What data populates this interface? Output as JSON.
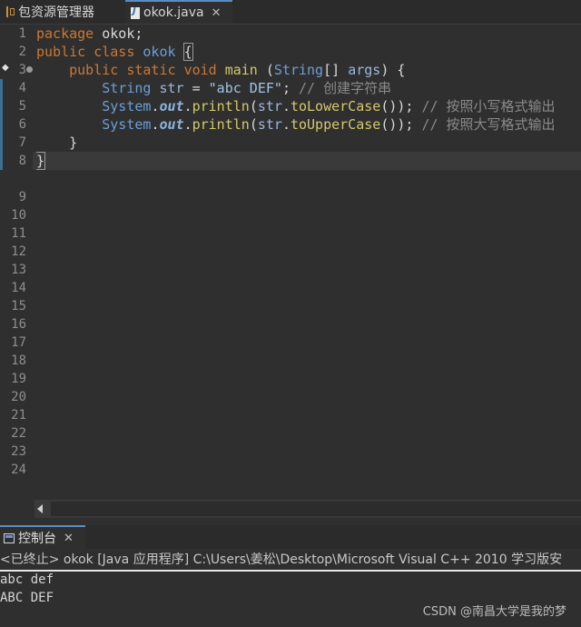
{
  "tabs": {
    "explorer_label": "包资源管理器",
    "editor_label": "okok.java",
    "close_glyph": "✕"
  },
  "editor": {
    "line_numbers": [
      "1",
      "2",
      "3",
      "4",
      "5",
      "6",
      "7",
      "8",
      "9",
      "10",
      "11",
      "12",
      "13",
      "14",
      "15",
      "16",
      "17",
      "18",
      "19",
      "20",
      "21",
      "22",
      "23",
      "24"
    ],
    "code": {
      "l1_kw": "package",
      "l1_rest": " okok;",
      "l2_kw1": "public",
      "l2_kw2": "class",
      "l2_name": "okok",
      "l2_brace": "{",
      "l3_kw1": "public",
      "l3_kw2": "static",
      "l3_kw3": "void",
      "l3_meth": "main",
      "l3_open": " (",
      "l3_type": "String",
      "l3_arr": "[] ",
      "l3_param": "args",
      "l3_close": ") {",
      "l4_type": "String",
      "l4_var": "str",
      "l4_eq": " = ",
      "l4_str": "\"abc DEF\"",
      "l4_semi": "; ",
      "l4_cmt": "// 创建字符串",
      "l5_type": "System",
      "l5_dot1": ".",
      "l5_fld": "out",
      "l5_dot2": ".",
      "l5_meth": "println",
      "l5_open": "(",
      "l5_var": "str",
      "l5_dot3": ".",
      "l5_call": "toLowerCase",
      "l5_close": "()); ",
      "l5_cmt": "// 按照小写格式输出",
      "l6_type": "System",
      "l6_dot1": ".",
      "l6_fld": "out",
      "l6_dot2": ".",
      "l6_meth": "println",
      "l6_open": "(",
      "l6_var": "str",
      "l6_dot3": ".",
      "l6_call": "toUpperCase",
      "l6_close": "()); ",
      "l6_cmt": "// 按照大写格式输出",
      "l7": "}",
      "l8": "}"
    }
  },
  "console": {
    "tab_label": "控制台",
    "close_glyph": "✕",
    "header": "<已终止> okok [Java 应用程序] C:\\Users\\姜松\\Desktop\\Microsoft Visual C++ 2010 学习版安",
    "output": [
      "abc def",
      "ABC DEF"
    ]
  },
  "watermark": "CSDN @南昌大学是我的梦",
  "colors": {
    "keyword": "#cc7832",
    "type": "#6b9fd6",
    "method": "#d6c86a",
    "string": "#9fc4e6",
    "comment": "#8a8a8a",
    "background": "#2f2f2f"
  }
}
